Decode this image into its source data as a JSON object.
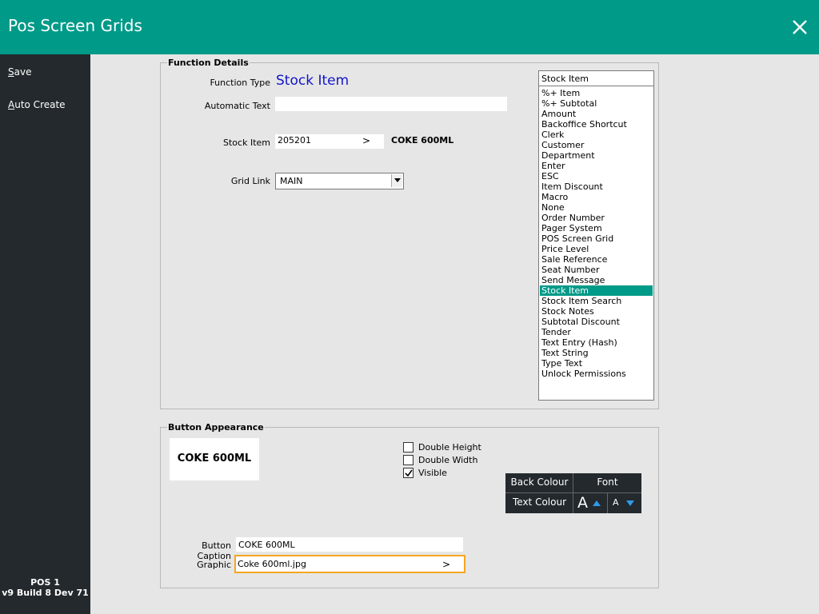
{
  "window": {
    "title": "Pos Screen Grids"
  },
  "sidebar": {
    "save": {
      "u": "S",
      "rest": "ave"
    },
    "auto_create": {
      "u": "A",
      "rest": "uto Create"
    },
    "footer_line1": "POS 1",
    "footer_line2": "v9 Build 8 Dev 71"
  },
  "function_details": {
    "legend": "Function Details",
    "function_type_label": "Function Type",
    "function_type_value": "Stock Item",
    "automatic_text_label": "Automatic Text",
    "automatic_text_value": "",
    "stock_item_label": "Stock Item",
    "stock_item_value": "205201",
    "stock_item_arrow": ">",
    "stock_item_desc": "COKE 600ML",
    "grid_link_label": "Grid Link",
    "grid_link_value": "MAIN",
    "function_list_header": "Stock Item",
    "function_list": [
      "%+ Item",
      "%+ Subtotal",
      "Amount",
      "Backoffice Shortcut",
      "Clerk",
      "Customer",
      "Department",
      "Enter",
      "ESC",
      "Item Discount",
      "Macro",
      "None",
      "Order Number",
      "Pager System",
      "POS Screen Grid",
      "Price Level",
      "Sale Reference",
      "Seat Number",
      "Send Message",
      "Stock Item",
      "Stock Item Search",
      "Stock Notes",
      "Subtotal Discount",
      "Tender",
      "Text Entry (Hash)",
      "Text String",
      "Type Text",
      "Unlock Permissions"
    ],
    "selected_function": "Stock Item"
  },
  "button_appearance": {
    "legend": "Button Appearance",
    "preview_text": "COKE 600ML",
    "double_height_label": "Double Height",
    "double_height": false,
    "double_width_label": "Double Width",
    "double_width": false,
    "visible_label": "Visible",
    "visible": true,
    "back_colour_label": "Back Colour",
    "font_label": "Font",
    "text_colour_label": "Text Colour",
    "font_increase_label": "A",
    "font_decrease_label": "A",
    "button_caption_label": "Button Caption",
    "button_caption_value": "COKE 600ML",
    "graphic_label": "Graphic",
    "graphic_value": "Coke 600ml.jpg",
    "graphic_arrow": ">"
  },
  "colors": {
    "accent": "#009a88",
    "sidebar": "#23292d",
    "highlight": "#f5a623",
    "function_type": "#1414c8",
    "arrow_blue": "#2f9bea"
  }
}
